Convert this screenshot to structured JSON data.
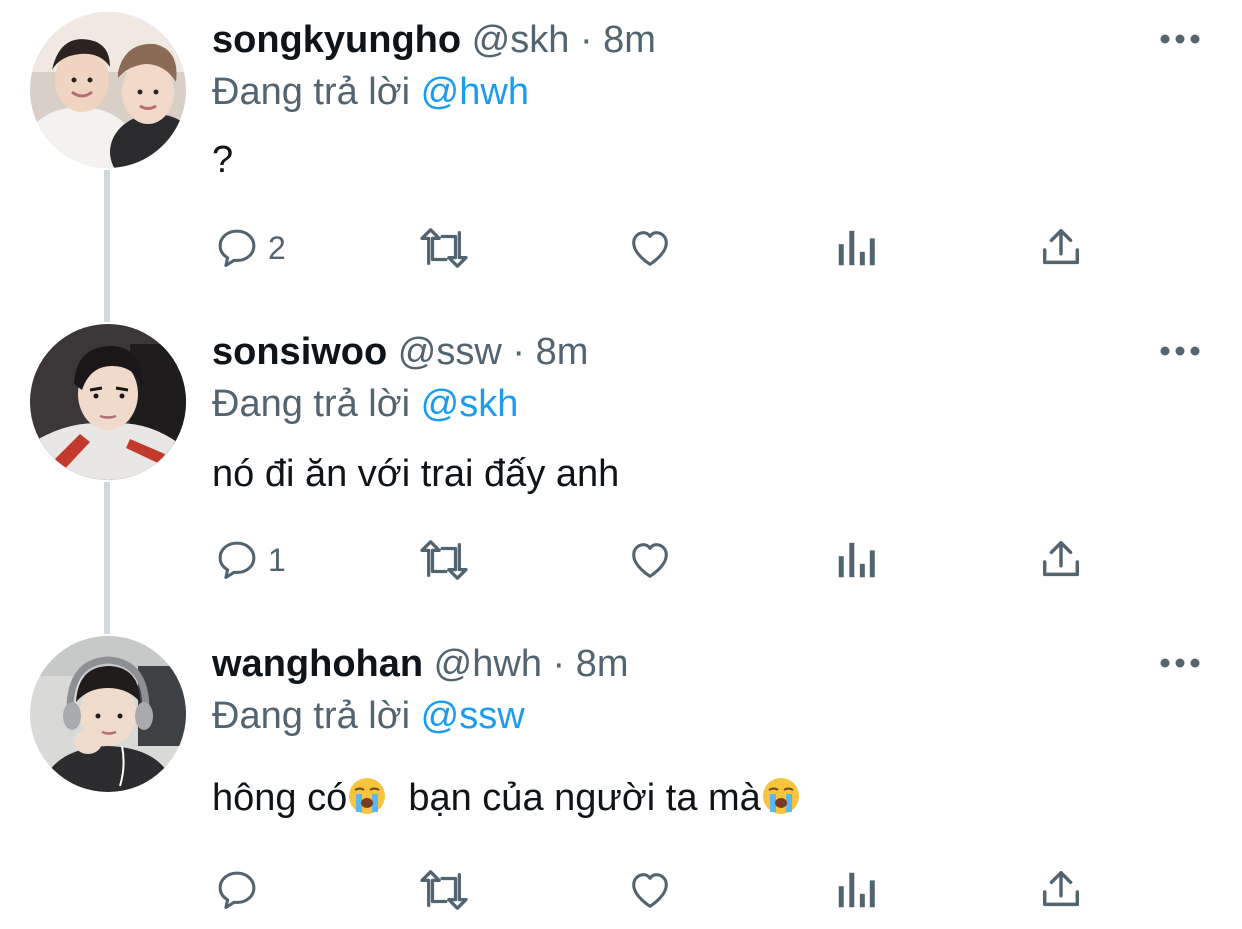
{
  "thread": {
    "tweets": [
      {
        "display_name": "songkyungho",
        "handle": "@skh",
        "separator": "·",
        "time": "8m",
        "replying_label": "Đang trả lời",
        "replying_to": "@hwh",
        "text": "?",
        "actions": {
          "reply_count": "2",
          "retweet_count": "",
          "like_count": ""
        }
      },
      {
        "display_name": "sonsiwoo",
        "handle": "@ssw",
        "separator": "·",
        "time": "8m",
        "replying_label": "Đang trả lời",
        "replying_to": "@skh",
        "text": "nó đi ăn với trai đấy anh",
        "actions": {
          "reply_count": "1",
          "retweet_count": "",
          "like_count": ""
        }
      },
      {
        "display_name": "wanghohan",
        "handle": "@hwh",
        "separator": "·",
        "time": "8m",
        "replying_label": "Đang trả lời",
        "replying_to": "@ssw",
        "text_part1": "hông có",
        "text_part2": "  bạn của người ta mà",
        "actions": {
          "reply_count": "",
          "retweet_count": "",
          "like_count": ""
        }
      }
    ]
  },
  "icons": {
    "reply": "reply-bubble-icon",
    "retweet": "retweet-icon",
    "like": "heart-icon",
    "views": "analytics-bars-icon",
    "share": "share-upload-icon",
    "more": "more-dots-icon",
    "emoji": "loudly-crying-face-emoji"
  },
  "colors": {
    "text": "#0f1419",
    "secondary": "#536471",
    "link": "#1d9bf0",
    "thread_line": "#cfd9de"
  }
}
